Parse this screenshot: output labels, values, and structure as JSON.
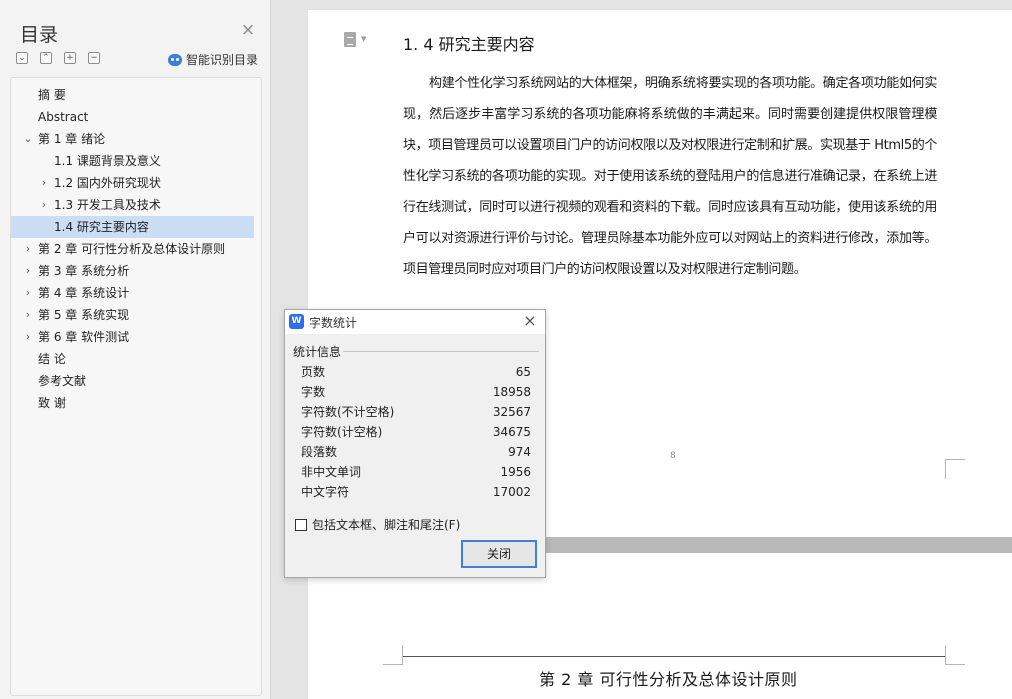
{
  "toc": {
    "title": "目录",
    "smart_label": "智能识别目录",
    "items": [
      {
        "label": "摘      要",
        "level": 1,
        "expander": "none",
        "active": false
      },
      {
        "label": "Abstract",
        "level": 1,
        "expander": "none",
        "active": false
      },
      {
        "label": "第 1 章  绪论",
        "level": 1,
        "expander": "expanded",
        "active": false
      },
      {
        "label": "1.1  课题背景及意义",
        "level": 2,
        "expander": "none",
        "active": false
      },
      {
        "label": "1.2  国内外研究现状",
        "level": 2,
        "expander": "collapsed",
        "active": false
      },
      {
        "label": "1.3 开发工具及技术",
        "level": 2,
        "expander": "collapsed",
        "active": false
      },
      {
        "label": "1.4 研究主要内容",
        "level": 2,
        "expander": "none",
        "active": true
      },
      {
        "label": "第 2 章  可行性分析及总体设计原则",
        "level": 1,
        "expander": "collapsed",
        "active": false
      },
      {
        "label": "第 3 章  系统分析",
        "level": 1,
        "expander": "collapsed",
        "active": false
      },
      {
        "label": "第 4 章  系统设计",
        "level": 1,
        "expander": "collapsed",
        "active": false
      },
      {
        "label": "第 5 章  系统实现",
        "level": 1,
        "expander": "collapsed",
        "active": false
      },
      {
        "label": "第 6 章  软件测试",
        "level": 1,
        "expander": "collapsed",
        "active": false
      },
      {
        "label": "结  论",
        "level": 1,
        "expander": "none",
        "active": false
      },
      {
        "label": "参考文献",
        "level": 1,
        "expander": "none",
        "active": false
      },
      {
        "label": "致    谢",
        "level": 1,
        "expander": "none",
        "active": false
      }
    ]
  },
  "document": {
    "heading": "1. 4 研究主要内容",
    "paragraph": "构建个性化学习系统网站的大体框架，明确系统将要实现的各项功能。确定各项功能如何实现，然后逐步丰富学习系统的各项功能麻将系统做的丰满起来。同时需要创建提供权限管理模块，项目管理员可以设置项目门户的访问权限以及对权限进行定制和扩展。实现基于 Html5的个性化学习系统的各项功能的实现。对于使用该系统的登陆用户的信息进行准确记录，在系统上进行在线测试，同时可以进行视频的观看和资料的下载。同时应该具有互动功能，使用该系统的用户可以对资源进行评价与讨论。管理员除基本功能外应可以对网站上的资料进行修改，添加等。项目管理员同时应对项目门户的访问权限设置以及对权限进行定制问题。",
    "page_number": "8",
    "next_heading": "第 2 章  可行性分析及总体设计原则"
  },
  "word_count": {
    "title": "字数统计",
    "section": "统计信息",
    "rows": [
      {
        "label": "页数",
        "value": "65"
      },
      {
        "label": "字数",
        "value": "18958"
      },
      {
        "label": "字符数(不计空格)",
        "value": "32567"
      },
      {
        "label": "字符数(计空格)",
        "value": "34675"
      },
      {
        "label": "段落数",
        "value": "974"
      },
      {
        "label": "非中文单词",
        "value": "1956"
      },
      {
        "label": "中文字符",
        "value": "17002"
      }
    ],
    "checkbox_label": "包括文本框、脚注和尾注(F)",
    "checkbox_checked": false,
    "close_label": "关闭"
  },
  "colors": {
    "active_item": "#cbdcf5",
    "button_focus": "#3f7fd6",
    "app_icon": "#2f6fe4"
  }
}
